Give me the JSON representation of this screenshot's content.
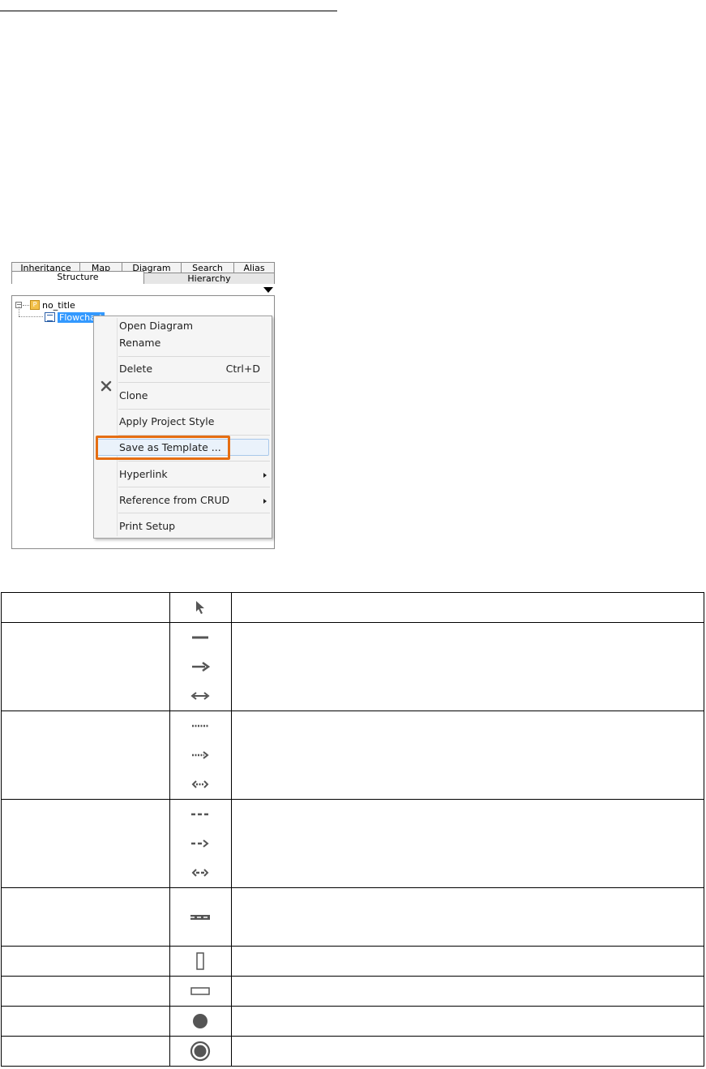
{
  "panel": {
    "tabs_back": [
      "Inheritance",
      "Map",
      "Diagram",
      "Search",
      "Alias"
    ],
    "tabs_front": [
      "Structure",
      "Hierarchy"
    ],
    "tree": {
      "root_label": "no_title",
      "root_icon_glyph": "P",
      "child_label": "Flowchart"
    },
    "context_menu": {
      "items": {
        "open_diagram": "Open Diagram",
        "rename": "Rename",
        "delete": "Delete",
        "delete_shortcut": "Ctrl+D",
        "clone": "Clone",
        "apply_project_style": "Apply Project Style",
        "save_as_template": "Save as Template ...",
        "hyperlink": "Hyperlink",
        "reference_from_crud": "Reference from CRUD",
        "print_setup": "Print Setup"
      },
      "highlight_color": "#e56e13"
    }
  },
  "tool_table": {
    "rows": [
      {
        "icons": [
          "select-arrow-icon"
        ]
      },
      {
        "icons": [
          "solid-line-icon",
          "solid-arrow-icon",
          "solid-double-arrow-icon"
        ]
      },
      {
        "icons": [
          "dotted-line-icon",
          "dotted-arrow-icon",
          "dotted-double-arrow-icon"
        ]
      },
      {
        "icons": [
          "dashed-line-icon",
          "dashed-arrow-icon",
          "dashed-double-arrow-icon"
        ]
      },
      {
        "icons": [
          "double-dashed-line-icon"
        ]
      },
      {
        "icons": [
          "vertical-rectangle-icon"
        ]
      },
      {
        "icons": [
          "horizontal-rectangle-icon"
        ]
      },
      {
        "icons": [
          "filled-circle-icon"
        ]
      },
      {
        "icons": [
          "ringed-circle-icon"
        ]
      }
    ]
  }
}
